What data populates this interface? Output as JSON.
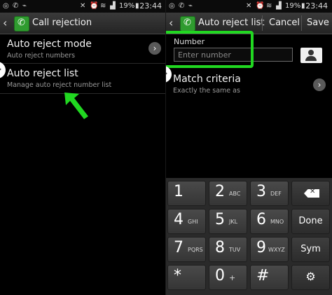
{
  "status_bar": {
    "left_icons": [
      "whatsapp-icon",
      "phone-icon",
      "usb-icon"
    ],
    "right_icons": [
      "mute-icon",
      "alarm-icon",
      "wifi-icon",
      "signal-icon"
    ],
    "battery": "19%",
    "time": "23:44"
  },
  "left_screen": {
    "title": "Call rejection",
    "items": [
      {
        "title": "Auto reject mode",
        "subtitle": "Auto reject numbers"
      },
      {
        "title": "Auto reject list",
        "subtitle": "Manage auto reject number list"
      }
    ]
  },
  "right_screen": {
    "title": "Auto reject list",
    "cancel_label": "Cancel",
    "save_label": "Save",
    "number_label": "Number",
    "number_placeholder": "Enter number",
    "number_value": "",
    "match_title": "Match criteria",
    "match_subtitle": "Exactly the same as"
  },
  "keypad": {
    "keys": [
      {
        "digit": "1",
        "letters": ""
      },
      {
        "digit": "2",
        "letters": "ABC"
      },
      {
        "digit": "3",
        "letters": "DEF"
      },
      {
        "digit": "4",
        "letters": "GHI"
      },
      {
        "digit": "5",
        "letters": "JKL"
      },
      {
        "digit": "6",
        "letters": "MNO"
      },
      {
        "digit": "7",
        "letters": "PQRS"
      },
      {
        "digit": "8",
        "letters": "TUV"
      },
      {
        "digit": "9",
        "letters": "WXYZ"
      },
      {
        "digit": "*",
        "letters": ""
      },
      {
        "digit": "0",
        "letters": "+"
      },
      {
        "digit": "#",
        "letters": ""
      }
    ],
    "done_label": "Done",
    "sym_label": "Sym",
    "backspace_icon": "backspace-icon",
    "settings_icon": "gear-icon"
  },
  "colors": {
    "highlight": "#21d821",
    "app_icon": "#2f9b2f",
    "background": "#000000"
  }
}
